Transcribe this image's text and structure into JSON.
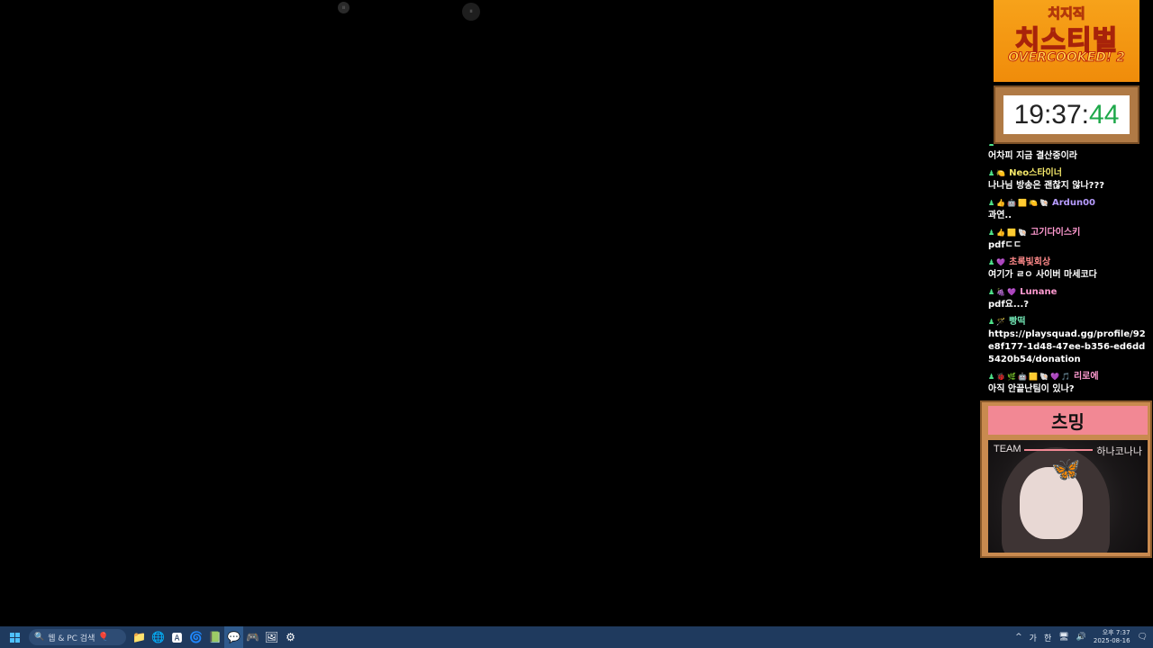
{
  "logo": {
    "top": "치지직",
    "main": "치스티벌",
    "sub": "OVERCOOKED! 2"
  },
  "clock": {
    "hm": "19:37:",
    "sec": "44"
  },
  "chat": [
    {
      "badges": [],
      "name": "",
      "color": "#ffffff",
      "text": "어차피 지금 결산중이라"
    },
    {
      "badges": [
        "🍋"
      ],
      "name": "Neo스타이너",
      "color": "#f5e86a",
      "text": "나나님 방송은 괜찮지 않나???"
    },
    {
      "badges": [
        "👍",
        "🤖",
        "🟨",
        "🍋",
        "🐚"
      ],
      "name": "Ardun00",
      "color": "#b79cff",
      "text": "과연.."
    },
    {
      "badges": [
        "👍",
        "🟨",
        "🐚"
      ],
      "name": "고기다이스키",
      "color": "#ff9ad0",
      "text": "pdfㄷㄷ"
    },
    {
      "badges": [
        "💜"
      ],
      "name": "초록빛회상",
      "color": "#ff8a8a",
      "text": "여기가 ㄹㅇ 사이버 마세코다"
    },
    {
      "badges": [
        "🍇",
        "💜"
      ],
      "name": "Lunane",
      "color": "#ff9ad0",
      "text": "pdf요...?"
    },
    {
      "badges": [
        "🪄"
      ],
      "name": "빵떡",
      "color": "#6fe0b0",
      "text": "https://playsquad.gg/profile/92e8f177-1d48-47ee-b356-ed6dd5420b54/donation"
    },
    {
      "badges": [
        "🐞",
        "🌿",
        "🤖",
        "🟨",
        "🐚",
        "💜",
        "🎵"
      ],
      "name": "리로에",
      "color": "#ff9ad0",
      "text": "아직 안끝난팀이 있나?"
    }
  ],
  "cam": {
    "name": "츠밍",
    "team_label": "TEAM",
    "team_name": "하나코나나"
  },
  "taskbar": {
    "search_placeholder": "웹 & PC 검색",
    "apps": [
      "📁",
      "🌐",
      "🅰",
      "🌀",
      "📗",
      "💬",
      "🎮",
      "🖼",
      "⚙"
    ],
    "ime1": "가",
    "ime2": "한",
    "ampm_time": "오후 7:37",
    "date": "2025-08-16"
  }
}
